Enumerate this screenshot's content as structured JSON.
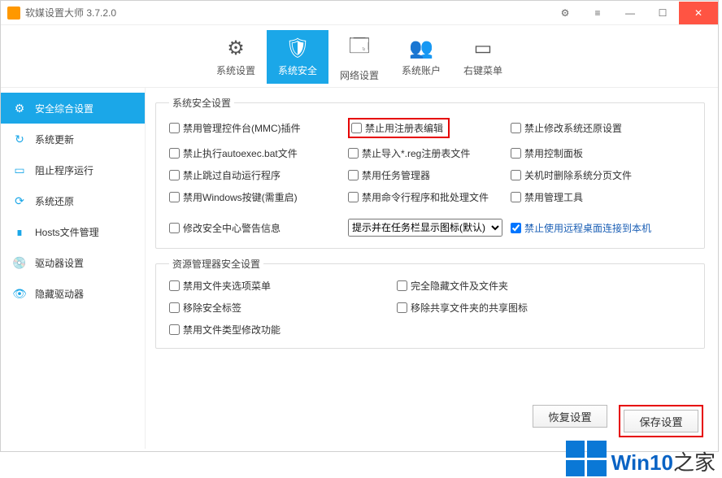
{
  "titlebar": {
    "title": "软媒设置大师 3.7.2.0"
  },
  "toolbar": {
    "items": [
      {
        "label": "系统设置",
        "icon": "⚙"
      },
      {
        "label": "系统安全",
        "icon": "🛡"
      },
      {
        "label": "网络设置",
        "icon": "🗔"
      },
      {
        "label": "系统账户",
        "icon": "👥"
      },
      {
        "label": "右键菜单",
        "icon": "▭"
      }
    ]
  },
  "sidebar": {
    "items": [
      {
        "label": "安全综合设置",
        "icon": "⚙"
      },
      {
        "label": "系统更新",
        "icon": "↻"
      },
      {
        "label": "阻止程序运行",
        "icon": "▭"
      },
      {
        "label": "系统还原",
        "icon": "⟳"
      },
      {
        "label": "Hosts文件管理",
        "icon": "∎"
      },
      {
        "label": "驱动器设置",
        "icon": "💿"
      },
      {
        "label": "隐藏驱动器",
        "icon": "👁"
      }
    ]
  },
  "group1": {
    "legend": "系统安全设置",
    "c": [
      [
        "禁用管理控件台(MMC)插件",
        "禁止用注册表编辑",
        "禁止修改系统还原设置"
      ],
      [
        "禁止执行autoexec.bat文件",
        "禁止导入*.reg注册表文件",
        "禁用控制面板"
      ],
      [
        "禁止跳过自动运行程序",
        "禁用任务管理器",
        "关机时删除系统分页文件"
      ],
      [
        "禁用Windows按键(需重启)",
        "禁用命令行程序和批处理文件",
        "禁用管理工具"
      ]
    ],
    "extra": {
      "chk": "修改安全中心警告信息",
      "select": "提示并在任务栏显示图标(默认)",
      "right": "禁止使用远程桌面连接到本机"
    }
  },
  "group2": {
    "legend": "资源管理器安全设置",
    "c": [
      [
        "禁用文件夹选项菜单",
        "完全隐藏文件及文件夹"
      ],
      [
        "移除安全标签",
        "移除共享文件夹的共享图标"
      ],
      [
        "禁用文件类型修改功能",
        ""
      ]
    ]
  },
  "footer": {
    "restore": "恢复设置",
    "save": "保存设置"
  },
  "watermark": {
    "brand": "Win10",
    "suffix": "之家"
  }
}
